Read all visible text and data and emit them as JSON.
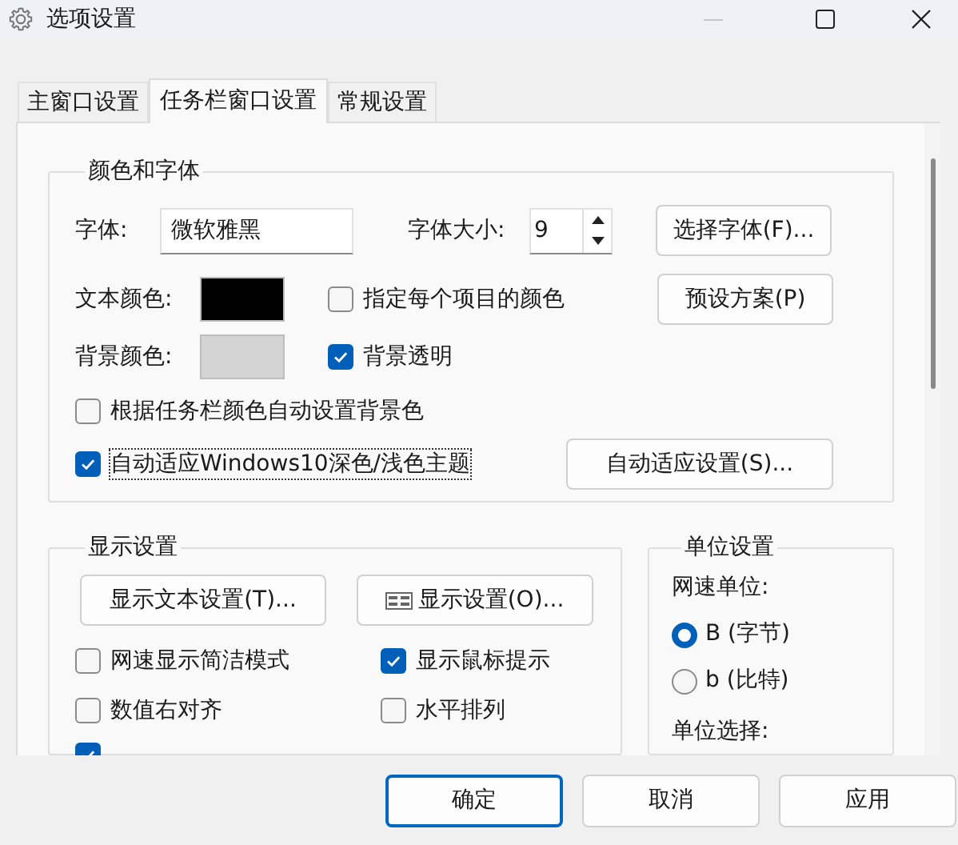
{
  "window": {
    "title": "选项设置"
  },
  "tabs": [
    {
      "label": "主窗口设置",
      "selected": false
    },
    {
      "label": "任务栏窗口设置",
      "selected": true
    },
    {
      "label": "常规设置",
      "selected": false
    }
  ],
  "color_font_group": {
    "title": "颜色和字体",
    "font_label": "字体:",
    "font_value": "微软雅黑",
    "size_label": "字体大小:",
    "size_value": "9",
    "choose_font_button": "选择字体(F)...",
    "preset_button": "预设方案(P)",
    "color_rows": [
      {
        "label": "文本颜色:",
        "color": "#000000",
        "checkbox": {
          "label": "指定每个项目的颜色",
          "checked": false
        }
      },
      {
        "label": "背景颜色:",
        "color": "#d4d4d4",
        "checkbox": {
          "label": "背景透明",
          "checked": true
        }
      }
    ],
    "auto_bg_checkbox": {
      "label": "根据任务栏颜色自动设置背景色",
      "checked": false
    },
    "auto_theme_checkbox": {
      "label": "自动适应Windows10深色/浅色主题",
      "checked": true
    },
    "auto_settings_button": "自动适应设置(S)..."
  },
  "display_group": {
    "title": "显示设置",
    "buttons": [
      {
        "label": "显示文本设置(T)...",
        "kind": "text"
      },
      {
        "label": "显示设置(O)...",
        "kind": "icon"
      }
    ],
    "checkboxes": [
      {
        "label": "网速显示简洁模式",
        "checked": false
      },
      {
        "label": "显示鼠标提示",
        "checked": true
      },
      {
        "label": "数值右对齐",
        "checked": false
      },
      {
        "label": "水平排列",
        "checked": false
      }
    ],
    "clipped_checkbox": {
      "checked": true
    }
  },
  "unit_group": {
    "title": "单位设置",
    "speed_unit_label": "网速单位:",
    "options": [
      {
        "label": "B (字节)",
        "selected": true
      },
      {
        "label": "b (比特)",
        "selected": false
      }
    ],
    "unit_choice_label": "单位选择:"
  },
  "buttons": [
    {
      "label": "确定",
      "default": true
    },
    {
      "label": "取消",
      "default": false
    },
    {
      "label": "应用",
      "default": false
    }
  ]
}
